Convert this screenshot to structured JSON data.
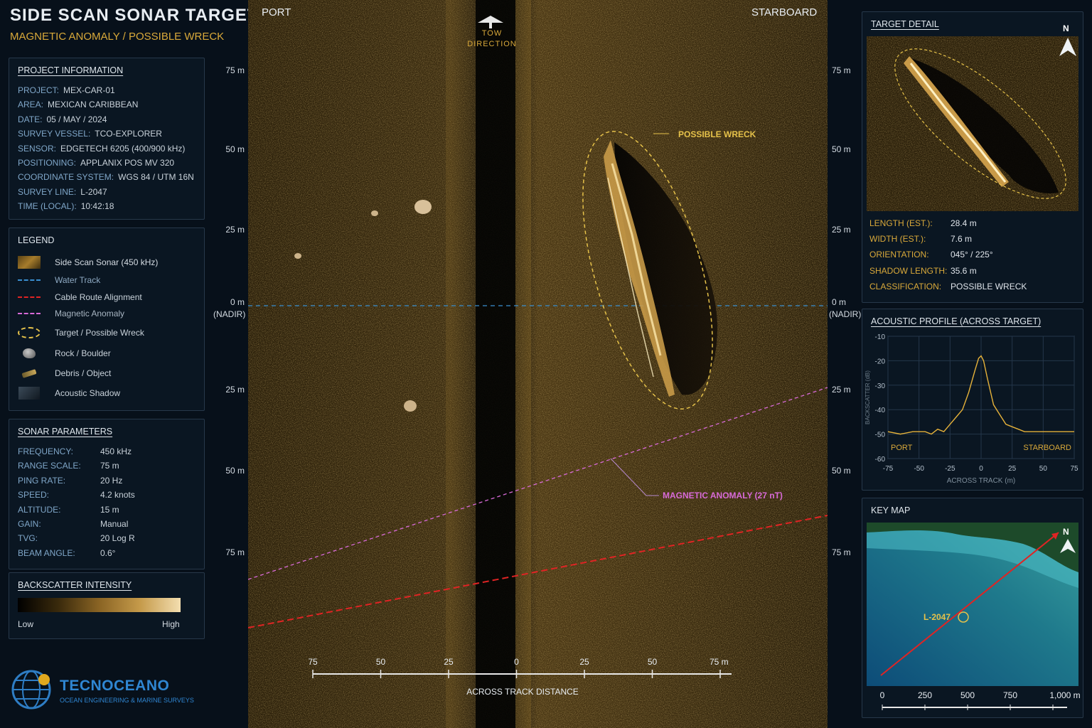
{
  "header": {
    "title": "SIDE SCAN SONAR TARGET",
    "subtitle": "MAGNETIC ANOMALY / POSSIBLE WRECK"
  },
  "project": {
    "title": "PROJECT INFORMATION",
    "rows": [
      {
        "k": "PROJECT:",
        "v": "MEX-CAR-01"
      },
      {
        "k": "AREA:",
        "v": "MEXICAN CARIBBEAN"
      },
      {
        "k": "DATE:",
        "v": "05 / MAY / 2024"
      },
      {
        "k": "SURVEY VESSEL:",
        "v": "TCO-EXPLORER"
      },
      {
        "k": "SENSOR:",
        "v": "EDGETECH 6205 (400/900 kHz)"
      },
      {
        "k": "POSITIONING:",
        "v": "APPLANIX POS MV 320"
      },
      {
        "k": "COORDINATE SYSTEM:",
        "v": "WGS 84 / UTM 16N"
      },
      {
        "k": "SURVEY LINE:",
        "v": "L-2047"
      },
      {
        "k": "TIME (LOCAL):",
        "v": "10:42:18"
      }
    ]
  },
  "legend": {
    "title": "LEGEND",
    "items": [
      {
        "label": "Side Scan Sonar (450 kHz)"
      },
      {
        "label": "Water Track"
      },
      {
        "label": "Cable Route Alignment"
      },
      {
        "label": "Magnetic Anomaly"
      },
      {
        "label": "Target / Possible Wreck"
      },
      {
        "label": "Rock / Boulder"
      },
      {
        "label": "Debris / Object"
      },
      {
        "label": "Acoustic Shadow"
      }
    ]
  },
  "sonar_params": {
    "title": "SONAR PARAMETERS",
    "rows": [
      {
        "k": "FREQUENCY:",
        "v": "450 kHz"
      },
      {
        "k": "RANGE SCALE:",
        "v": "75 m"
      },
      {
        "k": "PING RATE:",
        "v": "20 Hz"
      },
      {
        "k": "SPEED:",
        "v": "4.2 knots"
      },
      {
        "k": "ALTITUDE:",
        "v": "15 m"
      },
      {
        "k": "GAIN:",
        "v": "Manual"
      },
      {
        "k": "TVG:",
        "v": "20 Log R"
      },
      {
        "k": "BEAM ANGLE:",
        "v": "0.6°"
      }
    ]
  },
  "backscatter": {
    "title": "BACKSCATTER INTENSITY",
    "low": "Low",
    "high": "High"
  },
  "brand": {
    "name": "TECNOCEANO",
    "tagline": "OCEAN ENGINEERING & MARINE SURVEYS"
  },
  "sonar": {
    "port": "PORT",
    "starboard": "STARBOARD",
    "tow_direction": "TOW DIRECTION",
    "range_labels": [
      "75 m",
      "50 m",
      "25 m",
      "0 m",
      "25 m",
      "50 m",
      "75 m"
    ],
    "nadir": "(NADIR)",
    "possible_wreck": "POSSIBLE WRECK",
    "magnetic_anomaly": "MAGNETIC ANOMALY (27 nT)",
    "scale_ticks": [
      "75",
      "50",
      "25",
      "0",
      "25",
      "50",
      "75 m"
    ],
    "scale_title": "ACROSS TRACK DISTANCE"
  },
  "target_detail": {
    "title": "TARGET DETAIL",
    "north": "N",
    "rows": [
      {
        "k": "LENGTH (EST.):",
        "v": "28.4 m"
      },
      {
        "k": "WIDTH (EST.):",
        "v": "7.6 m"
      },
      {
        "k": "ORIENTATION:",
        "v": "045° / 225°"
      },
      {
        "k": "SHADOW LENGTH:",
        "v": "35.6 m"
      },
      {
        "k": "CLASSIFICATION:",
        "v": "POSSIBLE WRECK"
      }
    ]
  },
  "acoustic_profile": {
    "title": "ACOUSTIC PROFILE (ACROSS TARGET)",
    "ylabel": "BACKSCATTER (dB)",
    "xlabel": "ACROSS TRACK (m)",
    "port": "PORT",
    "starboard": "STARBOARD",
    "xticks": [
      "-75",
      "-50",
      "-25",
      "0",
      "25",
      "50",
      "75"
    ],
    "yticks": [
      "-10",
      "-20",
      "-30",
      "-40",
      "-50",
      "-60"
    ]
  },
  "key_map": {
    "title": "KEY MAP",
    "north": "N",
    "line_label": "L-2047",
    "scale_ticks": [
      "0",
      "250",
      "500",
      "750",
      "1,000 m"
    ]
  },
  "colors": {
    "accent_gold": "#d9a93a",
    "water_track": "#3a8fd0",
    "cable_route": "#e02424",
    "magnetic": "#d86ad8",
    "target": "#e6c24a"
  },
  "chart_data": {
    "type": "line",
    "x_label": "ACROSS TRACK (m)",
    "y_label": "BACKSCATTER (dB)",
    "xlim": [
      -75,
      75
    ],
    "ylim": [
      -60,
      -10
    ],
    "series": [
      {
        "x": [
          -75,
          -65,
          -55,
          -45,
          -40,
          -35,
          -30,
          -25,
          -20,
          -15,
          -10,
          -5,
          -2,
          0,
          2,
          5,
          10,
          15,
          20,
          25,
          30,
          35,
          40,
          45,
          55,
          65,
          75
        ],
        "values": [
          -49,
          -50,
          -49,
          -49,
          -50,
          -48,
          -49,
          -46,
          -43,
          -40,
          -33,
          -24,
          -19,
          -18,
          -20,
          -27,
          -38,
          -42,
          -46,
          -47,
          -48,
          -49,
          -49,
          -49,
          -49,
          -49,
          -49
        ]
      }
    ]
  }
}
